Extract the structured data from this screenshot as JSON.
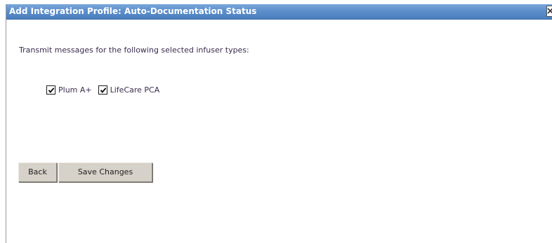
{
  "dialog": {
    "title": "Add Integration Profile: Auto-Documentation Status",
    "close_icon": "close-icon"
  },
  "main": {
    "instruction": "Transmit messages for the following selected infuser types:",
    "infusers": [
      {
        "label": "Plum A+",
        "checked": true
      },
      {
        "label": "LifeCare PCA",
        "checked": true
      }
    ]
  },
  "buttons": {
    "back_label": "Back",
    "save_label": "Save Changes"
  },
  "colors": {
    "titlebar": "#5d8fcb",
    "text": "#3a2d4e",
    "button_face": "#d6d1c9"
  }
}
